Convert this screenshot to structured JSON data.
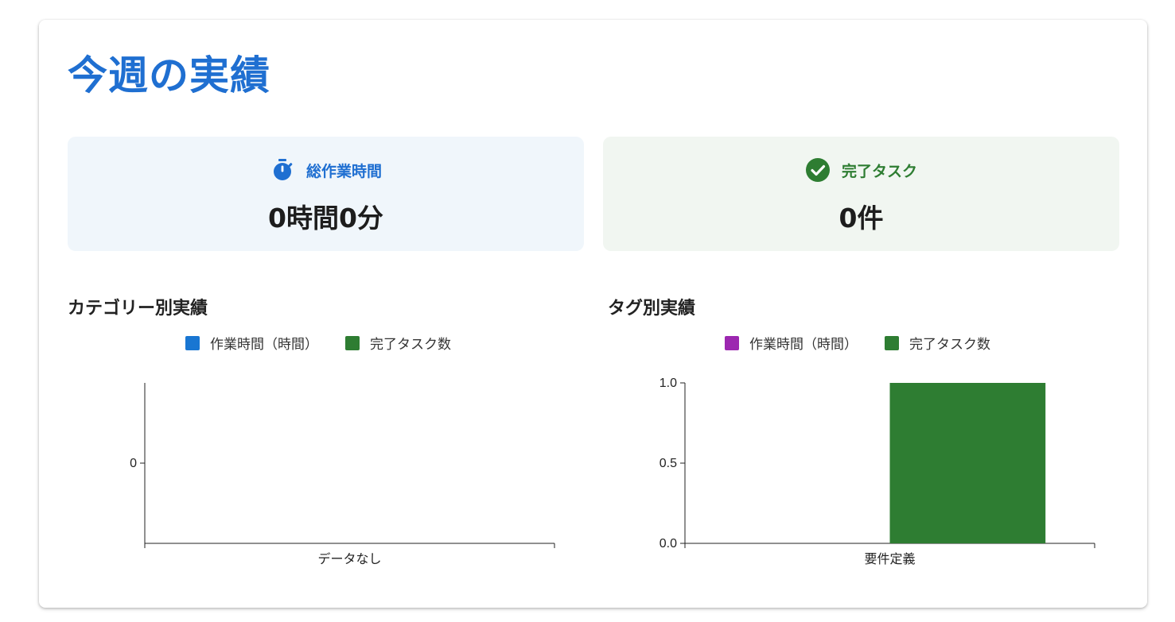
{
  "page": {
    "title": "今週の実績",
    "title_color": "#1f6fd1"
  },
  "stats": {
    "total_time": {
      "label": "総作業時間",
      "value": "0時間0分",
      "icon": "stopwatch-icon",
      "color": "#1f6fd1"
    },
    "completed_tasks": {
      "label": "完了タスク",
      "value": "0件",
      "icon": "check-circle-icon",
      "color": "#2e7d32"
    }
  },
  "category_chart": {
    "section_title": "カテゴリー別実績",
    "legend": [
      {
        "label": "作業時間（時間）",
        "color": "#1976d2"
      },
      {
        "label": "完了タスク数",
        "color": "#2e7d32"
      }
    ]
  },
  "tag_chart": {
    "section_title": "タグ別実績",
    "legend": [
      {
        "label": "作業時間（時間）",
        "color": "#9c27b0"
      },
      {
        "label": "完了タスク数",
        "color": "#2e7d32"
      }
    ]
  },
  "chart_data": [
    {
      "type": "bar",
      "title": "カテゴリー別実績",
      "categories": [
        "データなし"
      ],
      "series": [
        {
          "name": "作業時間（時間）",
          "values": [
            0
          ],
          "color": "#1976d2"
        },
        {
          "name": "完了タスク数",
          "values": [
            0
          ],
          "color": "#2e7d32"
        }
      ],
      "yticks": [
        "0"
      ],
      "grid": false,
      "legend_position": "top"
    },
    {
      "type": "bar",
      "title": "タグ別実績",
      "categories": [
        "要件定義"
      ],
      "series": [
        {
          "name": "作業時間（時間）",
          "values": [
            0
          ],
          "color": "#9c27b0"
        },
        {
          "name": "完了タスク数",
          "values": [
            1
          ],
          "color": "#2e7d32"
        }
      ],
      "ylim": [
        0,
        1
      ],
      "yticks": [
        "0.0",
        "0.5",
        "1.0"
      ],
      "grid": false,
      "legend_position": "top"
    }
  ]
}
